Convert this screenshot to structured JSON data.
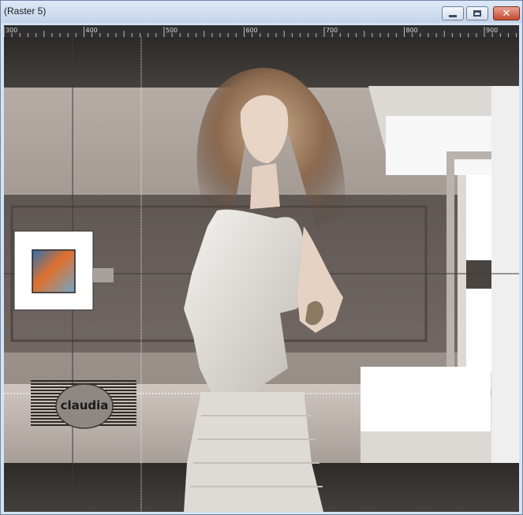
{
  "window": {
    "title": "(Raster 5)",
    "buttons": {
      "minimize": "minimize-icon",
      "maximize": "maximize-icon",
      "close": "close-icon"
    }
  },
  "ruler": {
    "labels": [
      "300",
      "400",
      "500",
      "600",
      "700",
      "800",
      "900"
    ]
  },
  "canvas": {
    "watermark_text": "claudia"
  },
  "colors": {
    "title_bar": "#c3d4eb",
    "ruler_bg": "#2f2f2f",
    "close_button": "#c44a30"
  }
}
